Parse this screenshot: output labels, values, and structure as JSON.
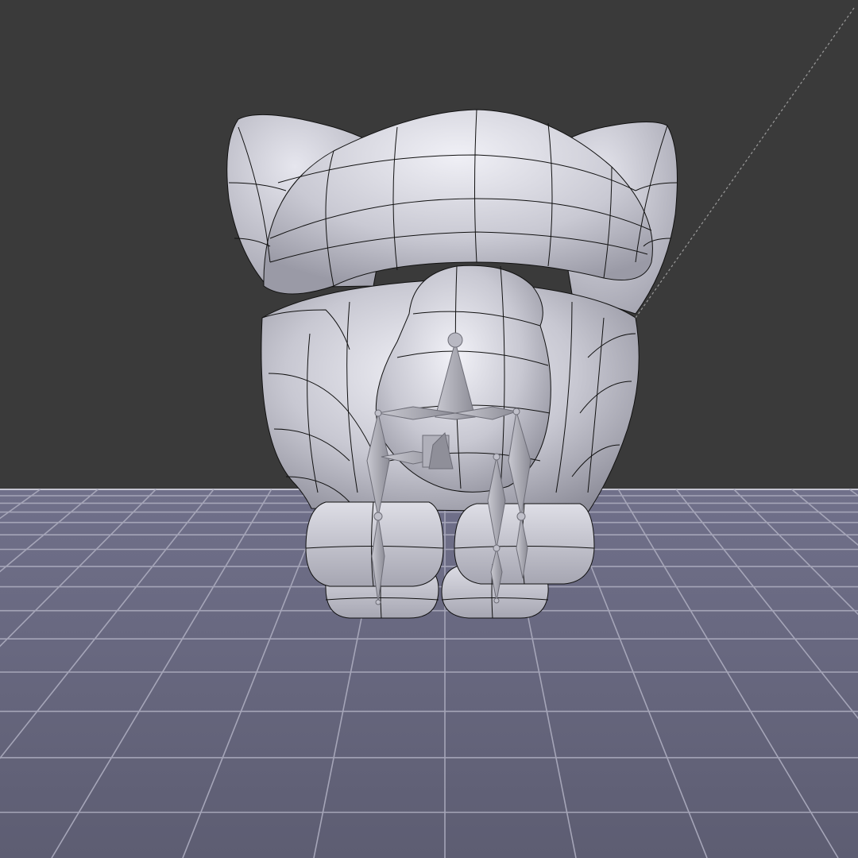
{
  "viewport": {
    "kind": "3d-viewport",
    "background_color": "#3a3a3a",
    "floor_color": "#62627a",
    "grid_line_color": "#a5a5b8",
    "horizon_line_color": "#d8d8e0"
  },
  "scene": {
    "mesh": {
      "kind": "subdivided-mesh",
      "shading": "solid",
      "wireframe_overlay": true,
      "base_color": "#d4d4de",
      "shadow_color": "#8e8e9a",
      "edge_color": "#111111"
    },
    "armature": {
      "kind": "armature",
      "display": "octahedral",
      "bone_color": "#9c9ca6",
      "bone_count": 7
    },
    "camera_guide": {
      "kind": "dashed-guide-line",
      "color": "#9a9a9a"
    }
  }
}
